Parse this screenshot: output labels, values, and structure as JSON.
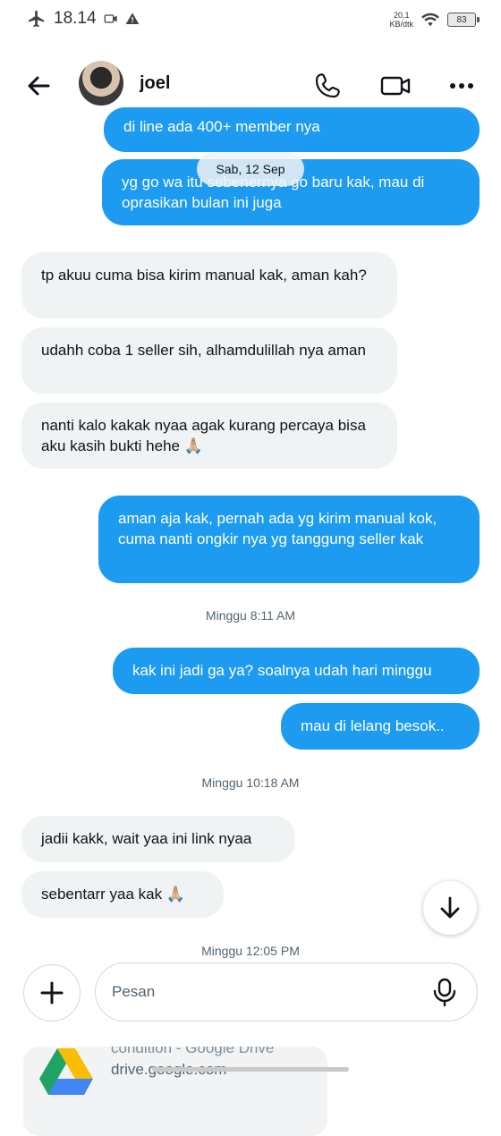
{
  "status_bar": {
    "time": "18.14",
    "net_speed_value": "20,1",
    "net_speed_unit": "KB/dtk",
    "battery": "83"
  },
  "header": {
    "contact_name": "joel"
  },
  "date_pill": "Sab, 12 Sep",
  "messages": [
    {
      "dir": "out",
      "text": "di line ada 400+ member nya"
    },
    {
      "dir": "out",
      "text": "yg go wa itu sebenernya go baru kak, mau di oprasikan bulan ini juga"
    },
    {
      "dir": "in",
      "text": "tp akuu cuma bisa kirim manual kak, aman kah?"
    },
    {
      "dir": "in",
      "text": "udahh coba 1 seller sih, alhamdulillah nya aman"
    },
    {
      "dir": "in",
      "text": "nanti kalo kakak nyaa agak kurang percaya bisa aku kasih bukti hehe 🙏🏼"
    },
    {
      "dir": "out",
      "text": "aman aja kak, pernah ada yg kirim manual kok, cuma nanti ongkir nya yg tanggung seller kak"
    },
    {
      "dir": "out",
      "text": "kak ini jadi ga ya? soalnya udah hari minggu"
    },
    {
      "dir": "out",
      "text": "mau di lelang besok.."
    },
    {
      "dir": "in",
      "text": "jadii kakk, wait yaa ini link nyaa"
    },
    {
      "dir": "in",
      "text": "sebentarr yaa kak 🙏🏼"
    }
  ],
  "timestamps": [
    "Minggu 8:11 AM",
    "Minggu 10:18 AM",
    "Minggu 12:05 PM"
  ],
  "composer": {
    "placeholder": "Pesan"
  },
  "link_card": {
    "title": "condition - Google Drive",
    "domain": "drive.google.com"
  },
  "colors": {
    "outgoing_bubble": "#1d9bf0",
    "incoming_bubble": "#eff3f4",
    "text": "#0f1419",
    "muted": "#536471"
  },
  "icons": [
    "airplane-icon",
    "screen-record-icon",
    "warning-icon",
    "wifi-icon",
    "battery-icon",
    "back-arrow-icon",
    "phone-icon",
    "video-call-icon",
    "more-icon",
    "arrow-down-icon",
    "plus-icon",
    "microphone-icon",
    "google-drive-icon"
  ]
}
